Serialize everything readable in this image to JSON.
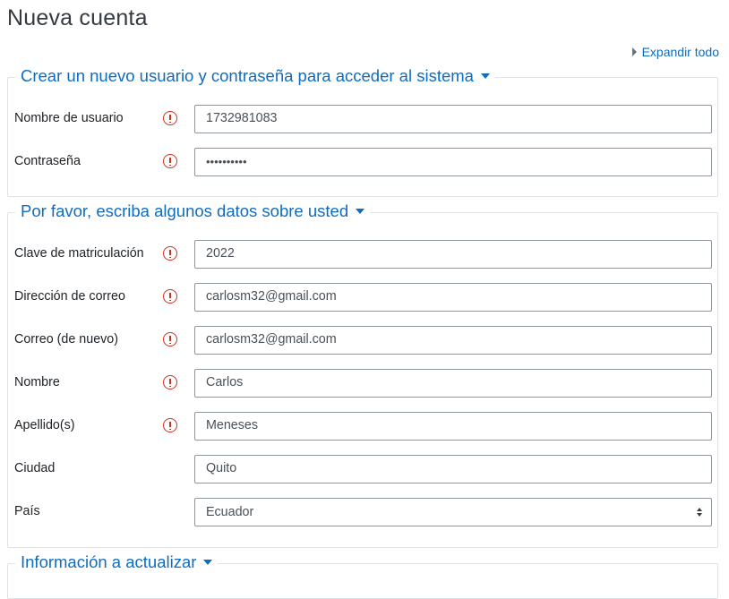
{
  "page": {
    "title": "Nueva cuenta",
    "expand_all": "Expandir todo"
  },
  "sections": {
    "account": {
      "legend": "Crear un nuevo usuario y contraseña para acceder al sistema",
      "fields": {
        "username": {
          "label": "Nombre de usuario",
          "value": "1732981083",
          "required": true
        },
        "password": {
          "label": "Contraseña",
          "value": "••••••••••",
          "required": true
        }
      }
    },
    "personal": {
      "legend": "Por favor, escriba algunos datos sobre usted",
      "fields": {
        "enrolkey": {
          "label": "Clave de matriculación",
          "value": "2022",
          "required": true
        },
        "email": {
          "label": "Dirección de correo",
          "value": "carlosm32@gmail.com",
          "required": true
        },
        "email2": {
          "label": "Correo (de nuevo)",
          "value": "carlosm32@gmail.com",
          "required": true
        },
        "firstname": {
          "label": "Nombre",
          "value": "Carlos",
          "required": true
        },
        "lastname": {
          "label": "Apellido(s)",
          "value": "Meneses",
          "required": true
        },
        "city": {
          "label": "Ciudad",
          "value": "Quito",
          "required": false
        },
        "country": {
          "label": "País",
          "value": "Ecuador",
          "required": false
        }
      }
    },
    "update": {
      "legend": "Información a actualizar"
    }
  },
  "icons": {
    "required": "exclamation-circle-icon",
    "expand": "triangle-right-icon",
    "collapse": "caret-down-icon"
  },
  "colors": {
    "link": "#0f6cbf",
    "required": "#ca3120",
    "border": "#dee2e6",
    "input_border": "#8f959e"
  }
}
